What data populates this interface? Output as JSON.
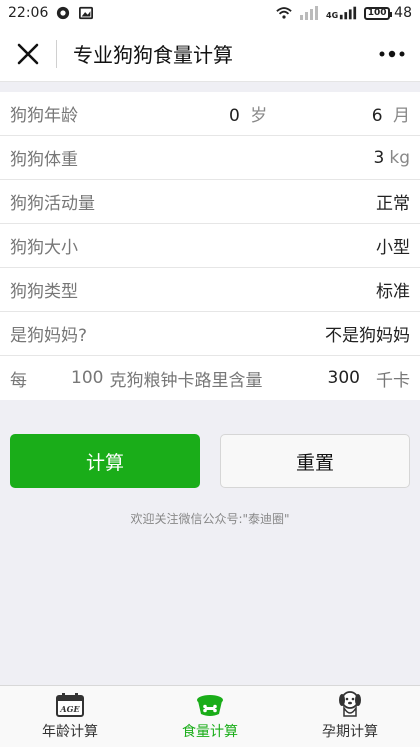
{
  "status_bar": {
    "time": "22:06",
    "battery_level": "100",
    "battery_percent": "48",
    "network": "4G"
  },
  "nav": {
    "title": "专业狗狗食量计算"
  },
  "form": {
    "age": {
      "label": "狗狗年龄",
      "years": "0",
      "years_unit": "岁",
      "months": "6",
      "months_unit": "月"
    },
    "weight": {
      "label": "狗狗体重",
      "value": "3",
      "unit": "kg"
    },
    "activity": {
      "label": "狗狗活动量",
      "value": "正常"
    },
    "size": {
      "label": "狗狗大小",
      "value": "小型"
    },
    "type": {
      "label": "狗狗类型",
      "value": "标准"
    },
    "mother": {
      "label": "是狗妈妈?",
      "value": "不是狗妈妈"
    },
    "calorie": {
      "prefix": "每",
      "grams": "100",
      "mid_text": "克狗粮钟卡路里含量",
      "kcal": "300",
      "unit": "千卡"
    }
  },
  "buttons": {
    "calculate": "计算",
    "reset": "重置"
  },
  "footer_note": "欢迎关注微信公众号:\"泰迪圈\"",
  "tabs": [
    {
      "label": "年龄计算",
      "icon": "calendar-age-icon",
      "active": false
    },
    {
      "label": "食量计算",
      "icon": "dog-bowl-icon",
      "active": true
    },
    {
      "label": "孕期计算",
      "icon": "puppy-icon",
      "active": false
    }
  ],
  "colors": {
    "primary": "#1aad19",
    "background": "#efeff4"
  }
}
